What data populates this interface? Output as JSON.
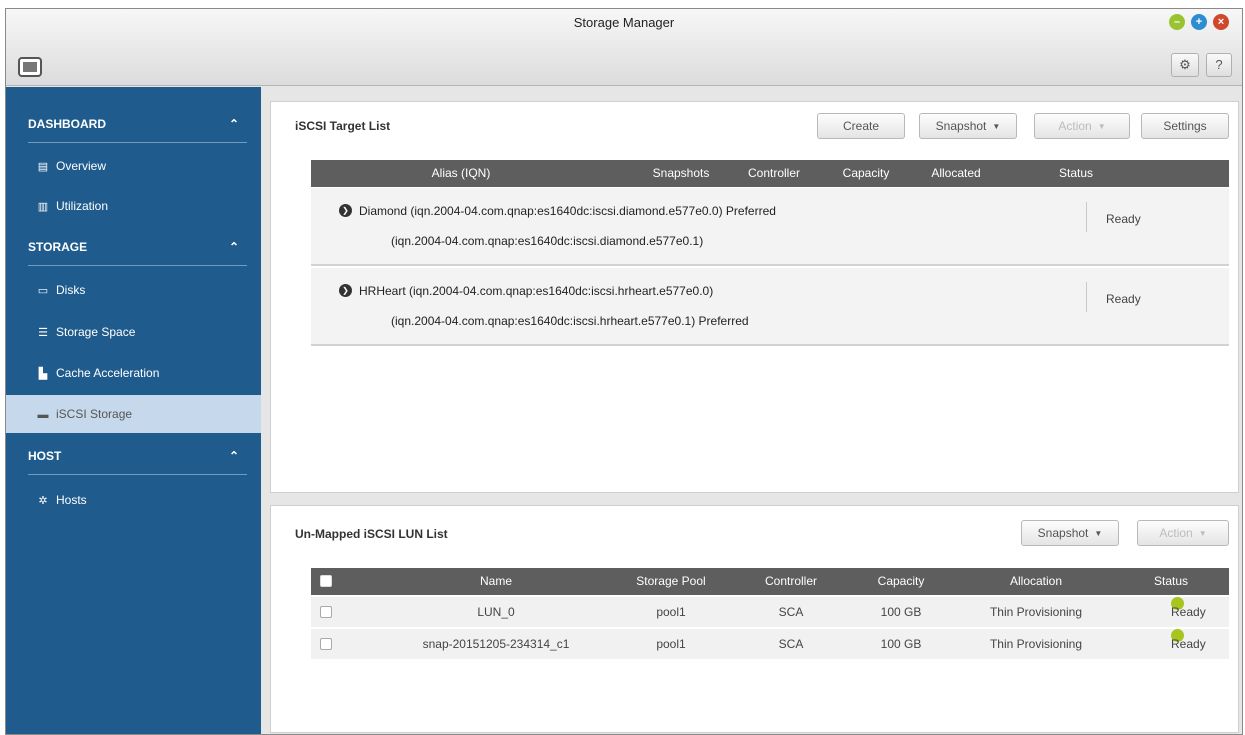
{
  "window": {
    "title": "Storage Manager"
  },
  "toolbar": {
    "gear_icon": "gear-icon",
    "help_label": "?"
  },
  "sidebar": {
    "sections": [
      {
        "label": "DASHBOARD",
        "items": [
          {
            "label": "Overview",
            "icon": "overview-icon"
          },
          {
            "label": "Utilization",
            "icon": "chart-icon"
          }
        ]
      },
      {
        "label": "STORAGE",
        "items": [
          {
            "label": "Disks",
            "icon": "disk-icon"
          },
          {
            "label": "Storage Space",
            "icon": "storage-space-icon"
          },
          {
            "label": "Cache Acceleration",
            "icon": "cache-icon"
          },
          {
            "label": "iSCSI Storage",
            "icon": "iscsi-icon",
            "active": true
          }
        ]
      },
      {
        "label": "HOST",
        "items": [
          {
            "label": "Hosts",
            "icon": "hosts-icon"
          }
        ]
      }
    ]
  },
  "target_list": {
    "title": "iSCSI Target List",
    "buttons": {
      "create": "Create",
      "snapshot": "Snapshot",
      "action": "Action",
      "settings": "Settings"
    },
    "columns": [
      "Alias (IQN)",
      "Snapshots",
      "Controller",
      "Capacity",
      "Allocated",
      "Status"
    ],
    "rows": [
      {
        "line1": "Diamond (iqn.2004-04.com.qnap:es1640dc:iscsi.diamond.e577e0.0) Preferred",
        "line2": "(iqn.2004-04.com.qnap:es1640dc:iscsi.diamond.e577e0.1)",
        "status": "Ready"
      },
      {
        "line1": "HRHeart (iqn.2004-04.com.qnap:es1640dc:iscsi.hrheart.e577e0.0)",
        "line2": "(iqn.2004-04.com.qnap:es1640dc:iscsi.hrheart.e577e0.1) Preferred",
        "status": "Ready"
      }
    ]
  },
  "lun_list": {
    "title": "Un-Mapped iSCSI LUN List",
    "buttons": {
      "snapshot": "Snapshot",
      "action": "Action"
    },
    "columns": [
      "Name",
      "Storage Pool",
      "Controller",
      "Capacity",
      "Allocation",
      "Status"
    ],
    "rows": [
      {
        "name": "LUN_0",
        "pool": "pool1",
        "controller": "SCA",
        "capacity": "100 GB",
        "allocation": "Thin Provisioning",
        "status": "Ready"
      },
      {
        "name": "snap-20151205-234314_c1",
        "pool": "pool1",
        "controller": "SCA",
        "capacity": "100 GB",
        "allocation": "Thin Provisioning",
        "status": "Ready"
      }
    ]
  },
  "colors": {
    "sidebar": "#1f5b8c",
    "active_item": "#c6d9ec",
    "table_header": "#5e5e5e",
    "ready": "#a8c51e"
  }
}
